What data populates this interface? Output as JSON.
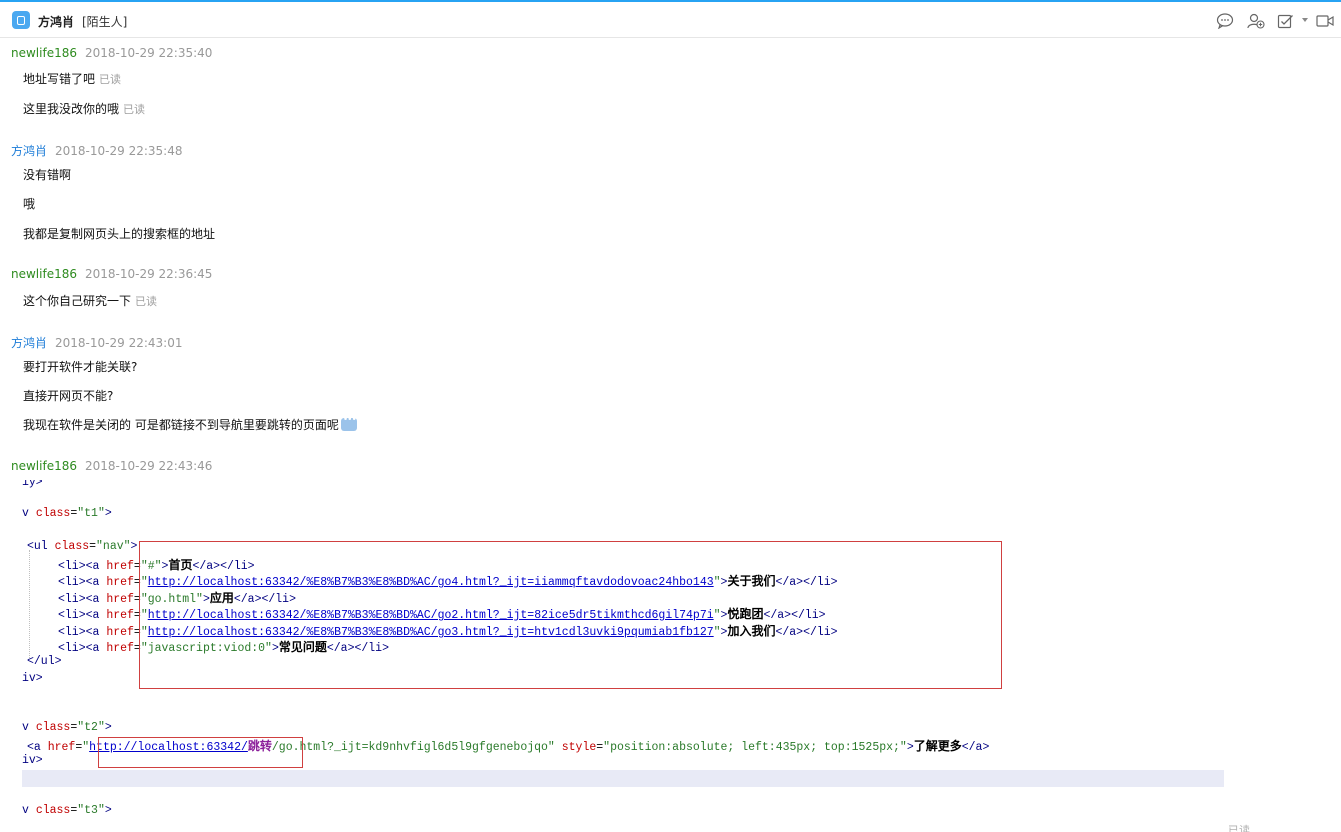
{
  "header": {
    "contact_name": "方鸿肖",
    "contact_tag": "[陌生人]",
    "icons": [
      "chat-bubble-icon",
      "add-user-icon",
      "task-check-icon",
      "video-call-icon"
    ]
  },
  "read_label": "已读",
  "messages": [
    {
      "sender": "newlife186",
      "time": "2018-10-29 22:35:40",
      "lines": [
        "地址写错了吧",
        "这里我没改你的哦"
      ]
    },
    {
      "sender": "方鸿肖",
      "time": "2018-10-29 22:35:48",
      "lines": [
        "没有错啊",
        "哦",
        "我都是复制网页头上的搜索框的地址"
      ]
    },
    {
      "sender": "newlife186",
      "time": "2018-10-29 22:36:45",
      "lines": [
        "这个你自己研究一下"
      ]
    },
    {
      "sender": "方鸿肖",
      "time": "2018-10-29 22:43:01",
      "lines": [
        "要打开软件才能关联?",
        "直接开网页不能?",
        "我现在软件是关闭的 可是都链接不到导航里要跳转的页面呢"
      ]
    },
    {
      "sender": "newlife186",
      "time": "2018-10-29 22:43:46",
      "lines": []
    }
  ],
  "code": {
    "l0": "iy>",
    "l1_a": "v ",
    "l1_attr": "class",
    "l1_eq": "=",
    "l1_val": "\"t1\"",
    "l1_end": ">",
    "l2_tag": "<ul ",
    "l2_attr": "class",
    "l2_eq": "=",
    "l2_val": "\"nav\"",
    "l2_end": ">",
    "items": [
      {
        "href": "\"#\"",
        "href_is_url": false,
        "text": "首页"
      },
      {
        "href": "http://localhost:63342/%E8%B7%B3%E8%BD%AC/go4.html?_ijt=iiammqftavdodovoac24hbo143",
        "href_is_url": true,
        "text": "关于我们"
      },
      {
        "href": "\"go.html\"",
        "href_is_url": false,
        "text": "应用"
      },
      {
        "href": "http://localhost:63342/%E8%B7%B3%E8%BD%AC/go2.html?_ijt=82ice5dr5tikmthcd6gil74p7i",
        "href_is_url": true,
        "text": "悦跑团"
      },
      {
        "href": "http://localhost:63342/%E8%B7%B3%E8%BD%AC/go3.html?_ijt=htv1cdl3uvki9pqumiab1fb127",
        "href_is_url": true,
        "text": "加入我们"
      },
      {
        "href": "\"javascript:viod:0\"",
        "href_is_url": false,
        "text": "常见问题"
      }
    ],
    "li_open": "<li><a ",
    "href_attr": "href",
    "li_close": "</a></li>",
    "ul_close": "</ul>",
    "div_close": "iv>",
    "l_t2_a": "v ",
    "l_t2_val": "\"t2\"",
    "t2_tag": "<a ",
    "t2_url": "http://localhost:63342/",
    "t2_jump": "跳转",
    "t2_rest": "/go.html?_ijt=kd9nhvfigl6d5l9gfgenebojqo\"",
    "t2_style_attr": "style",
    "t2_style_val": "\"position:absolute; left:435px; top:1525px;\"",
    "t2_text": "了解更多",
    "t2_close": "</a>",
    "l_t3_a": "v ",
    "l_t3_val": "\"t3\""
  }
}
